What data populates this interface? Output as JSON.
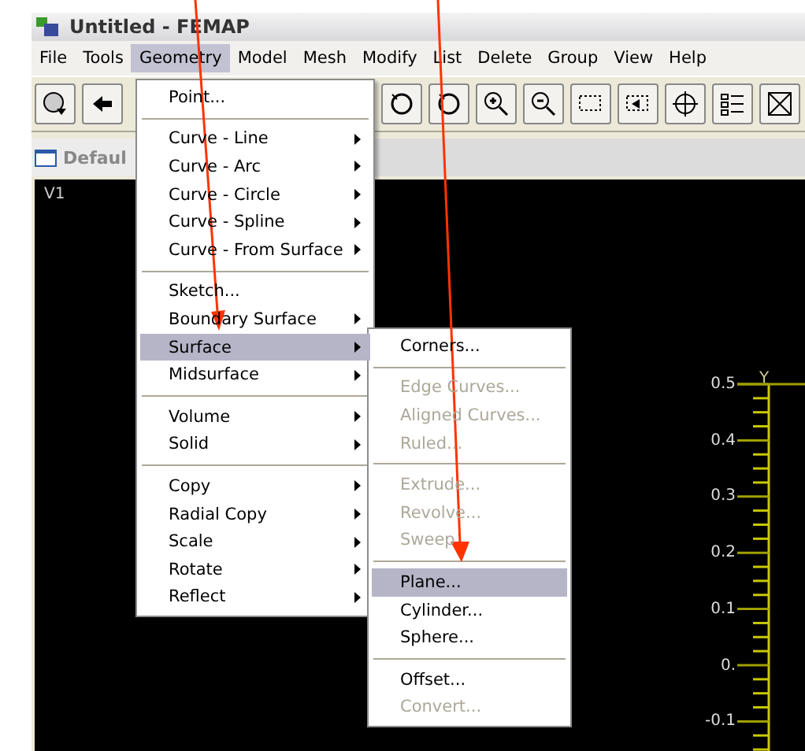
{
  "window": {
    "title": "Untitled - FEMAP"
  },
  "menubar": [
    {
      "label": "File",
      "selected": false
    },
    {
      "label": "Tools",
      "selected": false
    },
    {
      "label": "Geometry",
      "selected": true
    },
    {
      "label": "Model",
      "selected": false
    },
    {
      "label": "Mesh",
      "selected": false
    },
    {
      "label": "Modify",
      "selected": false
    },
    {
      "label": "List",
      "selected": false
    },
    {
      "label": "Delete",
      "selected": false
    },
    {
      "label": "Group",
      "selected": false
    },
    {
      "label": "View",
      "selected": false
    },
    {
      "label": "Help",
      "selected": false
    }
  ],
  "view_tab": {
    "title": "Defaul"
  },
  "viewport": {
    "label": "V1",
    "axis": {
      "title": "Y",
      "labels": [
        "0.5",
        "0.4",
        "0.3",
        "0.2",
        "0.1",
        "0.",
        "-0.1"
      ]
    }
  },
  "geometry_menu": {
    "groups": [
      {
        "items": [
          {
            "label": "Point...",
            "submenu": false,
            "selected": false
          }
        ]
      },
      {
        "items": [
          {
            "label": "Curve - Line",
            "submenu": true,
            "selected": false
          },
          {
            "label": "Curve - Arc",
            "submenu": true,
            "selected": false
          },
          {
            "label": "Curve - Circle",
            "submenu": true,
            "selected": false
          },
          {
            "label": "Curve - Spline",
            "submenu": true,
            "selected": false
          },
          {
            "label": "Curve - From Surface",
            "submenu": true,
            "selected": false
          }
        ]
      },
      {
        "items": [
          {
            "label": "Sketch...",
            "submenu": false,
            "selected": false
          },
          {
            "label": "Boundary Surface",
            "submenu": true,
            "selected": false
          },
          {
            "label": "Surface",
            "submenu": true,
            "selected": true
          },
          {
            "label": "Midsurface",
            "submenu": true,
            "selected": false
          }
        ]
      },
      {
        "items": [
          {
            "label": "Volume",
            "submenu": true,
            "selected": false
          },
          {
            "label": "Solid",
            "submenu": true,
            "selected": false
          }
        ]
      },
      {
        "items": [
          {
            "label": "Copy",
            "submenu": true,
            "selected": false
          },
          {
            "label": "Radial Copy",
            "submenu": true,
            "selected": false
          },
          {
            "label": "Scale",
            "submenu": true,
            "selected": false
          },
          {
            "label": "Rotate",
            "submenu": true,
            "selected": false
          },
          {
            "label": "Reflect",
            "submenu": true,
            "selected": false
          }
        ]
      }
    ]
  },
  "surface_submenu": {
    "groups": [
      {
        "items": [
          {
            "label": "Corners...",
            "disabled": false,
            "selected": false
          }
        ]
      },
      {
        "items": [
          {
            "label": "Edge Curves...",
            "disabled": true,
            "selected": false
          },
          {
            "label": "Aligned Curves...",
            "disabled": true,
            "selected": false
          },
          {
            "label": "Ruled...",
            "disabled": true,
            "selected": false
          }
        ]
      },
      {
        "items": [
          {
            "label": "Extrude...",
            "disabled": true,
            "selected": false
          },
          {
            "label": "Revolve...",
            "disabled": true,
            "selected": false
          },
          {
            "label": "Sweep",
            "disabled": true,
            "selected": false
          }
        ]
      },
      {
        "items": [
          {
            "label": "Plane...",
            "disabled": false,
            "selected": true
          },
          {
            "label": "Cylinder...",
            "disabled": false,
            "selected": false
          },
          {
            "label": "Sphere...",
            "disabled": false,
            "selected": false
          }
        ]
      },
      {
        "items": [
          {
            "label": "Offset...",
            "disabled": false,
            "selected": false
          },
          {
            "label": "Convert...",
            "disabled": true,
            "selected": false
          }
        ]
      }
    ]
  }
}
